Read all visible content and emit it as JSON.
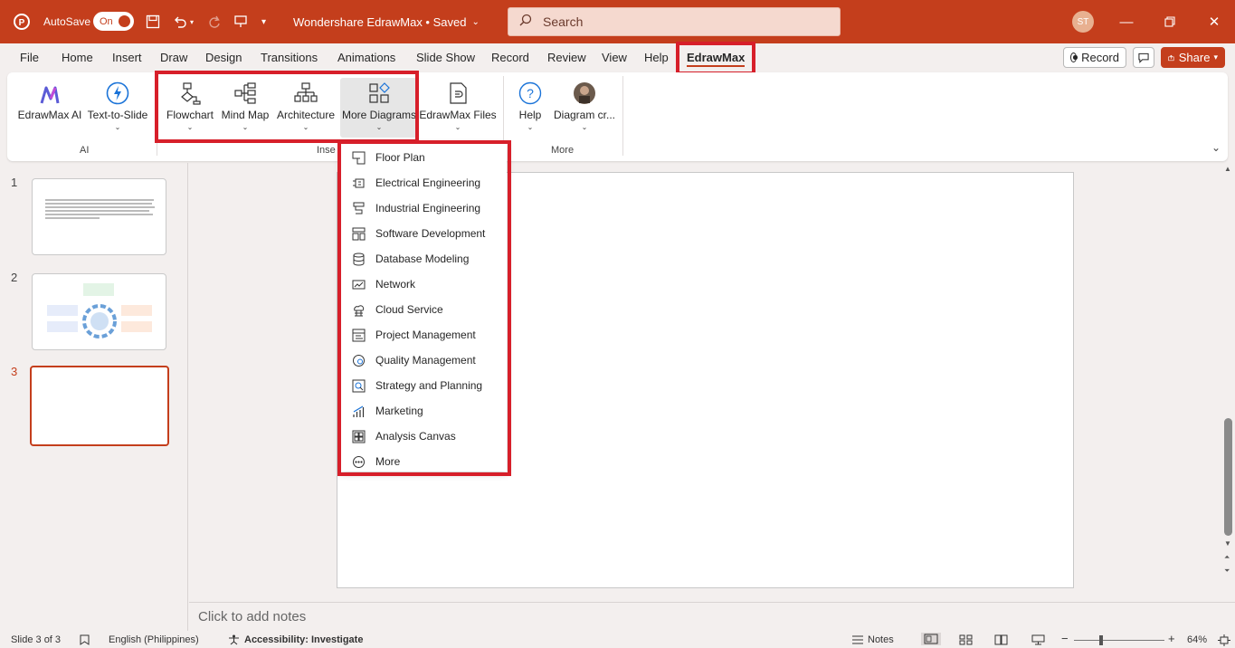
{
  "titlebar": {
    "autosave_label": "AutoSave",
    "autosave_state": "On",
    "doc_title": "Wondershare EdrawMax • Saved",
    "search_placeholder": "Search",
    "user_initials": "ST",
    "accent_color": "#c43e1c"
  },
  "menu": {
    "tabs": [
      "File",
      "Home",
      "Insert",
      "Draw",
      "Design",
      "Transitions",
      "Animations",
      "Slide Show",
      "Record",
      "Review",
      "View",
      "Help",
      "EdrawMax"
    ],
    "active_tab": "EdrawMax",
    "record_label": "Record",
    "share_label": "Share"
  },
  "ribbon": {
    "ai_group": {
      "label": "AI",
      "buttons": [
        "EdrawMax AI",
        "Text-to-Slide"
      ]
    },
    "insert_group": {
      "label": "Inse",
      "buttons": [
        "Flowchart",
        "Mind Map",
        "Architecture",
        "More Diagrams",
        "EdrawMax Files"
      ]
    },
    "more_group": {
      "label": "More",
      "buttons": [
        "Help",
        "Diagram cr..."
      ]
    }
  },
  "dropdown": {
    "items": [
      {
        "label": "Floor Plan",
        "icon": "floor-plan-icon"
      },
      {
        "label": "Electrical Engineering",
        "icon": "electrical-icon"
      },
      {
        "label": "Industrial Engineering",
        "icon": "industrial-icon"
      },
      {
        "label": "Software Development",
        "icon": "software-icon"
      },
      {
        "label": "Database Modeling",
        "icon": "database-icon"
      },
      {
        "label": "Network",
        "icon": "network-icon"
      },
      {
        "label": "Cloud Service",
        "icon": "cloud-icon"
      },
      {
        "label": "Project Management",
        "icon": "project-icon"
      },
      {
        "label": "Quality Management",
        "icon": "quality-icon"
      },
      {
        "label": "Strategy and Planning",
        "icon": "strategy-icon"
      },
      {
        "label": "Marketing",
        "icon": "marketing-icon"
      },
      {
        "label": "Analysis Canvas",
        "icon": "analysis-icon"
      },
      {
        "label": "More",
        "icon": "more-icon"
      }
    ]
  },
  "slides": {
    "numbers": [
      "1",
      "2",
      "3"
    ],
    "active": "3"
  },
  "notes": {
    "placeholder": "Click to add notes"
  },
  "status": {
    "slide_counter": "Slide 3 of 3",
    "language": "English (Philippines)",
    "accessibility": "Accessibility: Investigate",
    "notes_label": "Notes",
    "zoom": "64%"
  }
}
